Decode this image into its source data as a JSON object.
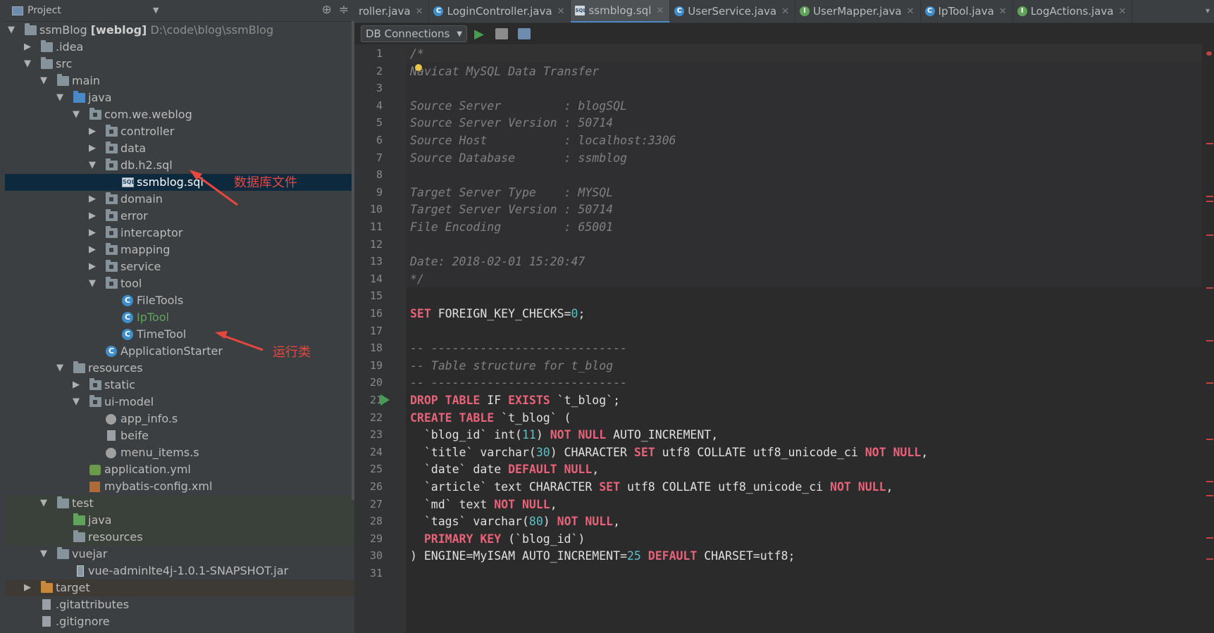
{
  "project_panel": {
    "title": "Project",
    "tree": [
      {
        "label": "ssmBlog",
        "bold": "[weblog]",
        "path": "D:\\code\\blog\\ssmBlog"
      },
      {
        "label": ".idea"
      },
      {
        "label": "src"
      },
      {
        "label": "main"
      },
      {
        "label": "java"
      },
      {
        "label": "com.we.weblog"
      },
      {
        "label": "controller"
      },
      {
        "label": "data"
      },
      {
        "label": "db.h2.sql"
      },
      {
        "label": "ssmblog.sql"
      },
      {
        "label": "domain"
      },
      {
        "label": "error"
      },
      {
        "label": "intercaptor"
      },
      {
        "label": "mapping"
      },
      {
        "label": "service"
      },
      {
        "label": "tool"
      },
      {
        "label": "FileTools"
      },
      {
        "label": "IpTool"
      },
      {
        "label": "TimeTool"
      },
      {
        "label": "ApplicationStarter"
      },
      {
        "label": "resources"
      },
      {
        "label": "static"
      },
      {
        "label": "ui-model"
      },
      {
        "label": "app_info.s"
      },
      {
        "label": "beife"
      },
      {
        "label": "menu_items.s"
      },
      {
        "label": "application.yml"
      },
      {
        "label": "mybatis-config.xml"
      },
      {
        "label": "test"
      },
      {
        "label": "java"
      },
      {
        "label": "resources"
      },
      {
        "label": "vuejar"
      },
      {
        "label": "vue-adminlte4j-1.0.1-SNAPSHOT.jar"
      },
      {
        "label": "target"
      },
      {
        "label": ".gitattributes"
      },
      {
        "label": ".gitignore"
      }
    ],
    "annotations": {
      "db_file": "数据库文件",
      "run_class": "运行类"
    }
  },
  "tabs": [
    {
      "label": "roller.java",
      "icon": "none"
    },
    {
      "label": "LoginController.java",
      "icon": "C"
    },
    {
      "label": "ssmblog.sql",
      "icon": "SQL",
      "active": true
    },
    {
      "label": "UserService.java",
      "icon": "C"
    },
    {
      "label": "UserMapper.java",
      "icon": "I"
    },
    {
      "label": "IpTool.java",
      "icon": "C"
    },
    {
      "label": "LogActions.java",
      "icon": "I"
    }
  ],
  "toolbar": {
    "db_connections": "DB Connections"
  },
  "code_lines": [
    {
      "n": "1"
    },
    {
      "n": "2"
    },
    {
      "n": "3"
    },
    {
      "n": "4"
    },
    {
      "n": "5"
    },
    {
      "n": "6"
    },
    {
      "n": "7"
    },
    {
      "n": "8"
    },
    {
      "n": "9"
    },
    {
      "n": "10"
    },
    {
      "n": "11"
    },
    {
      "n": "12"
    },
    {
      "n": "13"
    },
    {
      "n": "14"
    },
    {
      "n": "15"
    },
    {
      "n": "16"
    },
    {
      "n": "17"
    },
    {
      "n": "18"
    },
    {
      "n": "19"
    },
    {
      "n": "20"
    },
    {
      "n": "21"
    },
    {
      "n": "22"
    },
    {
      "n": "23"
    },
    {
      "n": "24"
    },
    {
      "n": "25"
    },
    {
      "n": "26"
    },
    {
      "n": "27"
    },
    {
      "n": "28"
    },
    {
      "n": "29"
    },
    {
      "n": "30"
    },
    {
      "n": "31"
    }
  ],
  "code": {
    "l1": "/*",
    "l2": "Navicat MySQL Data Transfer",
    "l4": "Source Server         : blogSQL",
    "l5": "Source Server Version : 50714",
    "l6": "Source Host           : localhost:3306",
    "l7": "Source Database       : ssmblog",
    "l9": "Target Server Type    : MYSQL",
    "l10": "Target Server Version : 50714",
    "l11": "File Encoding         : 65001",
    "l13": "Date: 2018-02-01 15:20:47",
    "l14": "*/",
    "l16a": "SET",
    "l16b": " FOREIGN_KEY_CHECKS=",
    "l16c": "0",
    "l16d": ";",
    "l18": "-- ----------------------------",
    "l19": "-- Table structure for t_blog",
    "l20": "-- ----------------------------",
    "l21a": "DROP TABLE",
    "l21b": " IF ",
    "l21c": "EXISTS",
    "l21d": " `t_blog`;",
    "l22a": "CREATE TABLE",
    "l22b": " `t_blog` (",
    "l23a": "  `blog_id` int(",
    "l23b": "11",
    "l23c": ") ",
    "l23d": "NOT NULL",
    "l23e": " AUTO_INCREMENT,",
    "l24a": "  `title` varchar(",
    "l24b": "30",
    "l24c": ") CHARACTER ",
    "l24d": "SET",
    "l24e": " utf8 COLLATE utf8_unicode_ci ",
    "l24f": "NOT NULL",
    "l24g": ",",
    "l25a": "  `date` date ",
    "l25b": "DEFAULT NULL",
    "l25c": ",",
    "l26a": "  `article` text CHARACTER ",
    "l26b": "SET",
    "l26c": " utf8 COLLATE utf8_unicode_ci ",
    "l26d": "NOT NULL",
    "l26e": ",",
    "l27a": "  `md` text ",
    "l27b": "NOT NULL",
    "l27c": ",",
    "l28a": "  `tags` varchar(",
    "l28b": "80",
    "l28c": ") ",
    "l28d": "NOT NULL",
    "l28e": ",",
    "l29a": "  ",
    "l29b": "PRIMARY KEY",
    "l29c": " (`blog_id`)",
    "l30a": ") ENGINE=MyISAM AUTO_INCREMENT=",
    "l30b": "25",
    "l30c": " ",
    "l30d": "DEFAULT",
    "l30e": " CHARSET=utf8;"
  },
  "colors": {
    "keyword": "#e8627a",
    "comment": "#808080",
    "number": "#5cc0c8",
    "selection": "#0d293e",
    "annotation": "#e8473f"
  }
}
